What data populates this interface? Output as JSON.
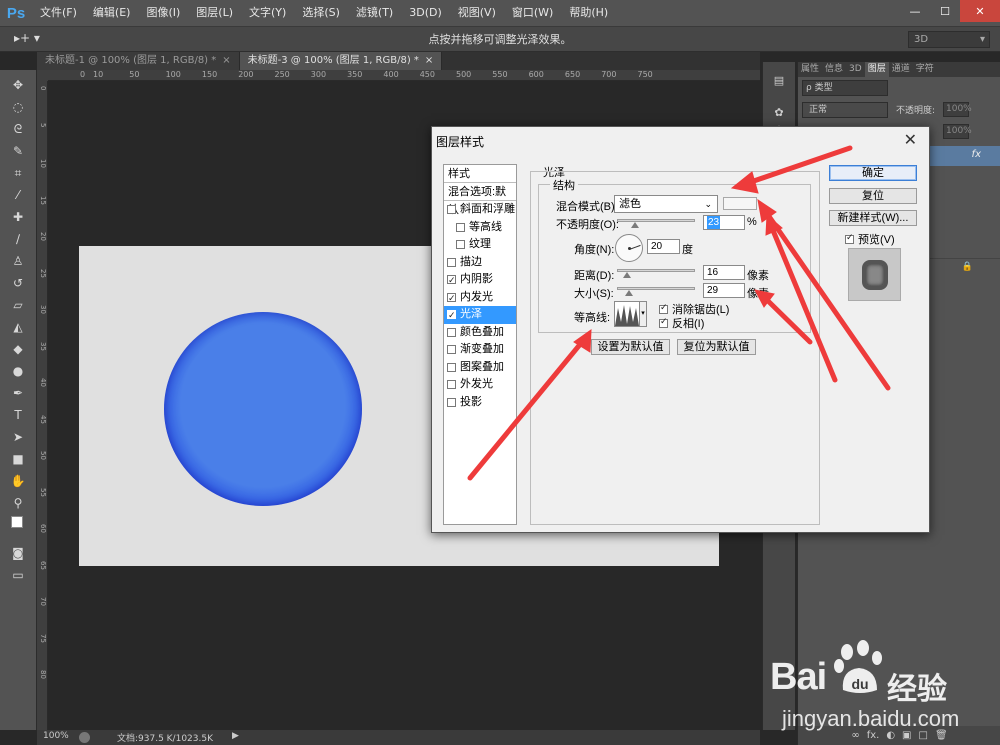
{
  "app": {
    "logo": "Ps",
    "menu": [
      "文件(F)",
      "编辑(E)",
      "图像(I)",
      "图层(L)",
      "文字(Y)",
      "选择(S)",
      "滤镜(T)",
      "3D(D)",
      "视图(V)",
      "窗口(W)",
      "帮助(H)"
    ],
    "window_controls": {
      "minimize": "—",
      "maximize": "☐",
      "close": "✕"
    }
  },
  "options_bar": {
    "tool_preset": "▸+ ▾",
    "hint": "点按并拖移可调整光泽效果。",
    "workspace": "3D"
  },
  "tabs": [
    {
      "label": "未标题-1 @ 100% (图层 1, RGB/8) *",
      "close": "×",
      "active": false
    },
    {
      "label": "未标题-3 @ 100% (图层 1, RGB/8) *",
      "close": "×",
      "active": true
    }
  ],
  "rulers": {
    "top": [
      "0",
      "10",
      "50",
      "100",
      "150",
      "200",
      "250",
      "300",
      "350",
      "400",
      "450",
      "500",
      "550",
      "600",
      "650",
      "700",
      "750"
    ],
    "left": [
      "0",
      "5",
      "10",
      "15",
      "20",
      "25",
      "30",
      "35",
      "40",
      "45",
      "50",
      "55",
      "60",
      "65",
      "70",
      "75",
      "80"
    ]
  },
  "status_bar": {
    "zoom": "100%",
    "doc_info": "文档:937.5 K/1023.5K",
    "arrow": "▶"
  },
  "layers_panel": {
    "tabs": [
      "属性",
      "信息",
      "3D",
      "图层",
      "通道",
      "字符"
    ],
    "active_tab": "图层",
    "filter": "ρ 类型",
    "blend_mode": "正常",
    "opacity_label": "不透明度:",
    "opacity": "100%",
    "fill": "100%",
    "fx": "fx",
    "bottom_icons": [
      "∞",
      "fx.",
      "◐",
      "▣",
      "□",
      "🗑"
    ]
  },
  "dialog": {
    "title": "图层样式",
    "close": "✕",
    "styles_header": "样式",
    "blend_options": "混合选项:默认",
    "styles": [
      {
        "label": "斜面和浮雕",
        "checked": false,
        "indent": false,
        "selected": false
      },
      {
        "label": "等高线",
        "checked": false,
        "indent": true,
        "selected": false
      },
      {
        "label": "纹理",
        "checked": false,
        "indent": true,
        "selected": false
      },
      {
        "label": "描边",
        "checked": false,
        "indent": false,
        "selected": false
      },
      {
        "label": "内阴影",
        "checked": true,
        "indent": false,
        "selected": false
      },
      {
        "label": "内发光",
        "checked": true,
        "indent": false,
        "selected": false
      },
      {
        "label": "光泽",
        "checked": true,
        "indent": false,
        "selected": true
      },
      {
        "label": "颜色叠加",
        "checked": false,
        "indent": false,
        "selected": false
      },
      {
        "label": "渐变叠加",
        "checked": false,
        "indent": false,
        "selected": false
      },
      {
        "label": "图案叠加",
        "checked": false,
        "indent": false,
        "selected": false
      },
      {
        "label": "外发光",
        "checked": false,
        "indent": false,
        "selected": false
      },
      {
        "label": "投影",
        "checked": false,
        "indent": false,
        "selected": false
      }
    ],
    "satin": {
      "group_title": "光泽",
      "structure_title": "结构",
      "blend_mode_label": "混合模式(B):",
      "blend_mode": "滤色",
      "opacity_label": "不透明度(O):",
      "opacity": "23",
      "opacity_unit": "%",
      "opacity_fraction": 0.23,
      "angle_label": "角度(N):",
      "angle": "20",
      "angle_unit": "度",
      "distance_label": "距离(D):",
      "distance": "16",
      "distance_unit": "像素",
      "size_label": "大小(S):",
      "size": "29",
      "size_unit": "像素",
      "contour_label": "等高线:",
      "antialias_label": "消除锯齿(L)",
      "antialias": true,
      "invert_label": "反相(I)",
      "invert": true,
      "set_default": "设置为默认值",
      "reset_default": "复位为默认值"
    },
    "buttons": {
      "ok": "确定",
      "reset": "复位",
      "new_style": "新建样式(W)...",
      "preview_label": "预览(V)",
      "preview": true
    }
  },
  "colors": {
    "accent_selection": "#3399ff",
    "annotation_arrow": "#ee3b3b",
    "circle_blue": "#3b6be6"
  },
  "watermark": {
    "brand": "Bai",
    "paw": "du",
    "site": "经验",
    "url": "jingyan.baidu.com"
  }
}
